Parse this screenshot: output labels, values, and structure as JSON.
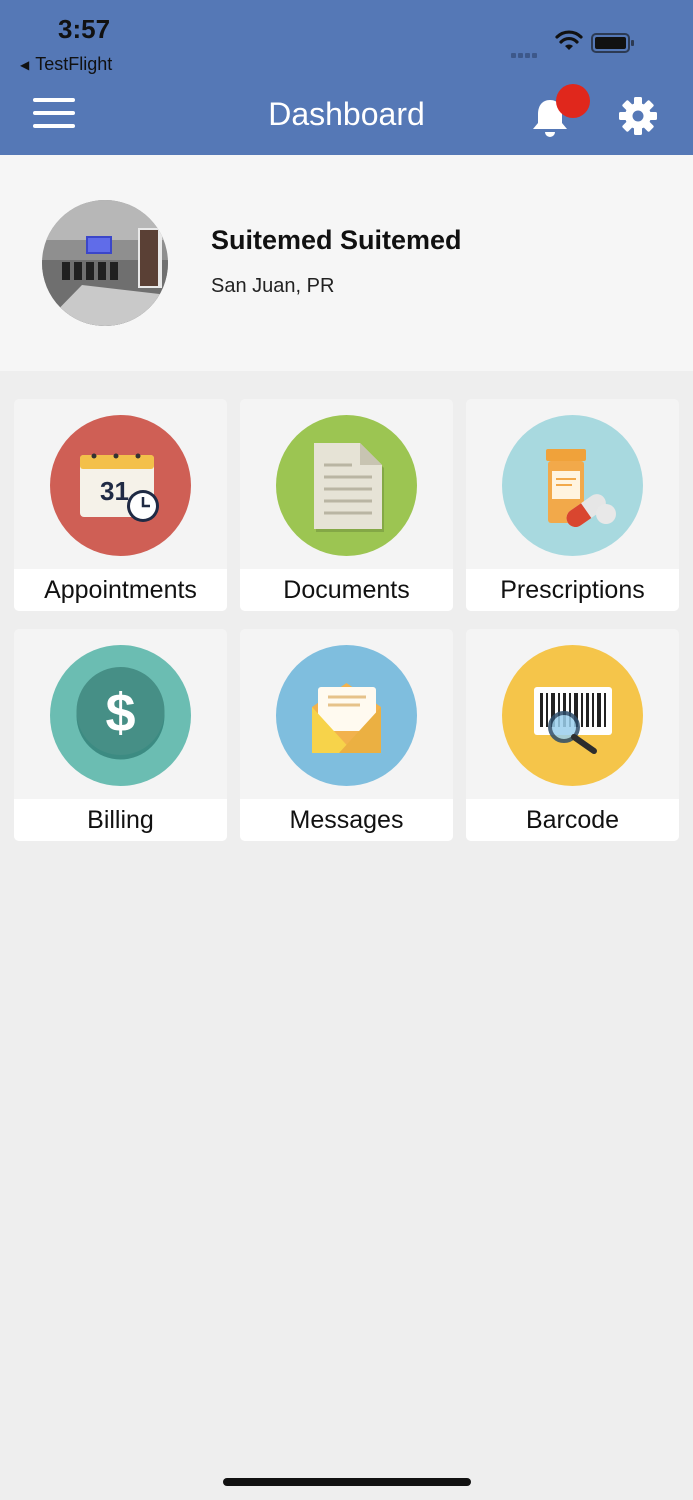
{
  "status_bar": {
    "time": "3:57",
    "back_app": "TestFlight",
    "back_arrow_icon": "back-triangle-icon",
    "signal_icon": "signal-icon",
    "wifi_icon": "wifi-icon",
    "battery_icon": "battery-icon"
  },
  "header": {
    "title": "Dashboard",
    "menu_icon": "hamburger-menu-icon",
    "bell_icon": "bell-icon",
    "settings_icon": "gear-icon",
    "notification_dot_color": "#e0271c",
    "bar_color": "#5578b6"
  },
  "profile": {
    "name": "Suitemed Suitemed",
    "location": "San Juan, PR"
  },
  "tiles": [
    {
      "label": "Appointments",
      "icon": "calendar-clock-icon",
      "color": "#cf5f55"
    },
    {
      "label": "Documents",
      "icon": "document-icon",
      "color": "#9cc552"
    },
    {
      "label": "Prescriptions",
      "icon": "pill-bottle-icon",
      "color": "#a8d9df"
    },
    {
      "label": "Billing",
      "icon": "dollar-icon",
      "color": "#6bbdb2"
    },
    {
      "label": "Messages",
      "icon": "envelope-icon",
      "color": "#7fbede"
    },
    {
      "label": "Barcode",
      "icon": "barcode-scan-icon",
      "color": "#f5c54a"
    }
  ]
}
